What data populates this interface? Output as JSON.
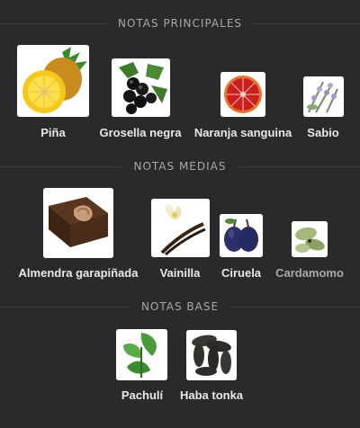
{
  "sections": [
    {
      "title": "NOTAS PRINCIPALES",
      "notes": [
        {
          "label": "Piña",
          "icon": "pineapple-icon"
        },
        {
          "label": "Grosella negra",
          "icon": "blackcurrant-icon"
        },
        {
          "label": "Naranja sanguina",
          "icon": "blood-orange-icon"
        },
        {
          "label": "Sabio",
          "icon": "sage-icon"
        }
      ]
    },
    {
      "title": "NOTAS MEDIAS",
      "notes": [
        {
          "label": "Almendra garapiñada",
          "icon": "candied-almond-icon"
        },
        {
          "label": "Vainilla",
          "icon": "vanilla-icon"
        },
        {
          "label": "Ciruela",
          "icon": "plum-icon"
        },
        {
          "label": "Cardamomo",
          "icon": "cardamom-icon"
        }
      ]
    },
    {
      "title": "NOTAS BASE",
      "notes": [
        {
          "label": "Pachulí",
          "icon": "patchouli-icon"
        },
        {
          "label": "Haba tonka",
          "icon": "tonka-bean-icon"
        }
      ]
    }
  ]
}
